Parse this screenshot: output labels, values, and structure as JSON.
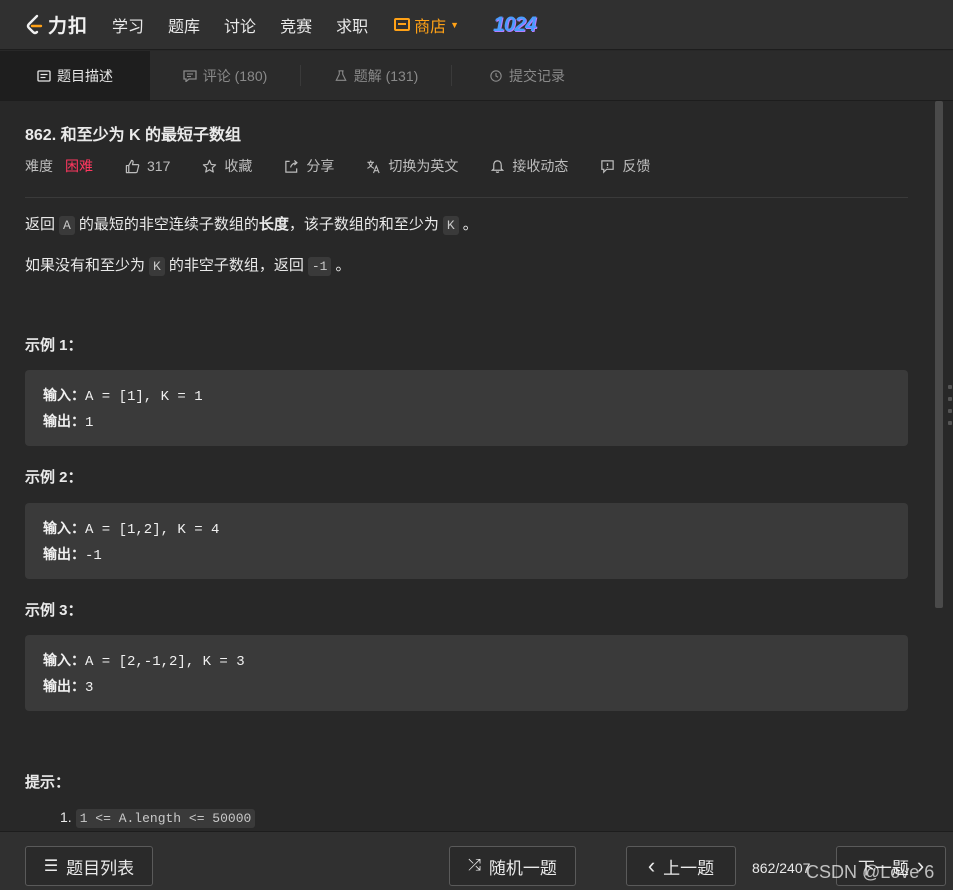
{
  "nav": {
    "logo_text": "力扣",
    "items": [
      "学习",
      "题库",
      "讨论",
      "竞赛",
      "求职"
    ],
    "shop_label": "商店",
    "badge": "1024"
  },
  "tabs": [
    {
      "label": "题目描述",
      "icon": "description-icon"
    },
    {
      "label": "评论 (180)",
      "icon": "comment-icon"
    },
    {
      "label": "题解 (131)",
      "icon": "flask-icon"
    },
    {
      "label": "提交记录",
      "icon": "clock-icon"
    }
  ],
  "problem": {
    "title": "862. 和至少为 K 的最短子数组",
    "difficulty_label": "难度",
    "difficulty": "困难",
    "likes": "317",
    "favorite": "收藏",
    "share": "分享",
    "switch_lang": "切换为英文",
    "subscribe": "接收动态",
    "feedback": "反馈",
    "desc1": {
      "a": "返回",
      "code1": "A",
      "b": "的最短的非空连续子数组的",
      "bold": "长度",
      "c": "，该子数组的和至少为",
      "code2": "K",
      "d": "。"
    },
    "desc2": {
      "a": "如果没有和至少为",
      "code1": "K",
      "b": "的非空子数组，返回",
      "code2": "-1",
      "c": "。"
    },
    "examples": [
      {
        "heading": "示例 1：",
        "input_label": "输入：",
        "input": "A = [1], K = 1",
        "output_label": "输出：",
        "output": "1"
      },
      {
        "heading": "示例 2：",
        "input_label": "输入：",
        "input": "A = [1,2], K = 4",
        "output_label": "输出：",
        "output": "-1"
      },
      {
        "heading": "示例 3：",
        "input_label": "输入：",
        "input": "A = [2,-1,2], K = 3",
        "output_label": "输出：",
        "output": "3"
      }
    ],
    "hint_heading": "提示：",
    "hint_number": "1.",
    "hint_item": "1 <= A.length <= 50000"
  },
  "bottom": {
    "list_label": "题目列表",
    "random_label": "随机一题",
    "prev_label": "上一题",
    "pager": "862/2407",
    "next_label": "下一题",
    "watermark": "CSDN @Love 6"
  }
}
